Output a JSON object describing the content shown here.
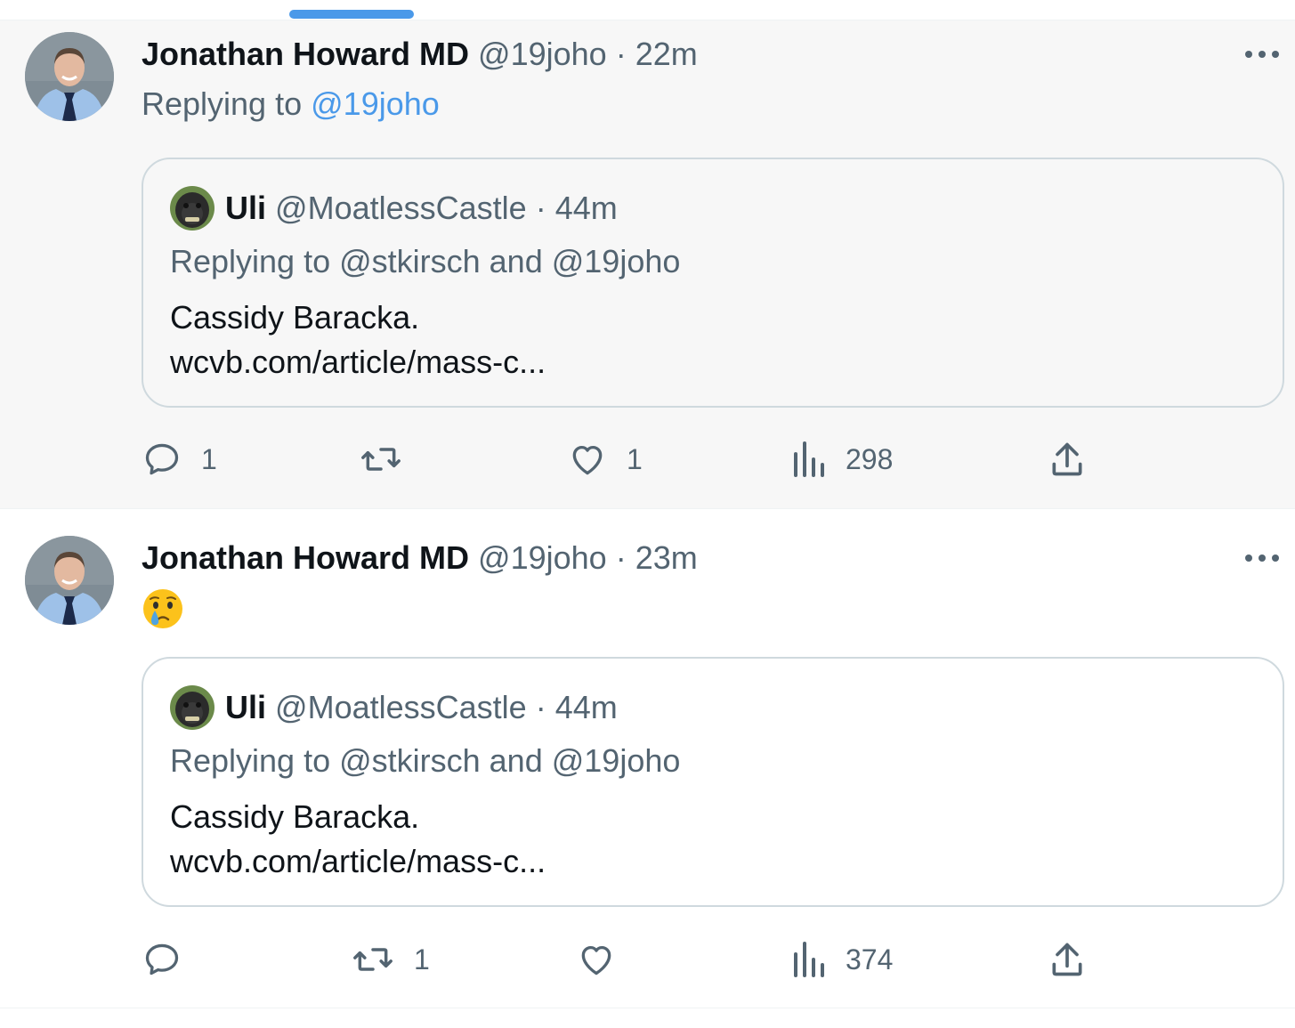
{
  "tweets": [
    {
      "author_name": "Jonathan Howard MD",
      "handle": "@19joho",
      "separator": "·",
      "time": "22m",
      "replying_prefix": "Replying to",
      "replying_mention": "@19joho",
      "emoji": "",
      "quote": {
        "name": "Uli",
        "handle": "@MoatlessCastle",
        "separator": "·",
        "time": "44m",
        "replying": "Replying to @stkirsch and @19joho",
        "text_line1": "Cassidy Baracka.",
        "text_line2": "wcvb.com/article/mass-c..."
      },
      "actions": {
        "replies": "1",
        "retweets": "",
        "likes": "1",
        "views": "298"
      }
    },
    {
      "author_name": "Jonathan Howard MD",
      "handle": "@19joho",
      "separator": "·",
      "time": "23m",
      "replying_prefix": "",
      "replying_mention": "",
      "emoji": "crying-face",
      "quote": {
        "name": "Uli",
        "handle": "@MoatlessCastle",
        "separator": "·",
        "time": "44m",
        "replying": "Replying to @stkirsch and @19joho",
        "text_line1": "Cassidy Baracka.",
        "text_line2": "wcvb.com/article/mass-c..."
      },
      "actions": {
        "replies": "",
        "retweets": "1",
        "likes": "",
        "views": "374"
      }
    }
  ],
  "colors": {
    "link": "#4a99e9",
    "secondary_text": "#536471",
    "primary_text": "#0f1419",
    "border": "#cfd9de"
  },
  "icons": [
    "more-icon",
    "reply-icon",
    "retweet-icon",
    "like-icon",
    "views-icon",
    "share-icon",
    "avatar",
    "crying-face-emoji"
  ]
}
